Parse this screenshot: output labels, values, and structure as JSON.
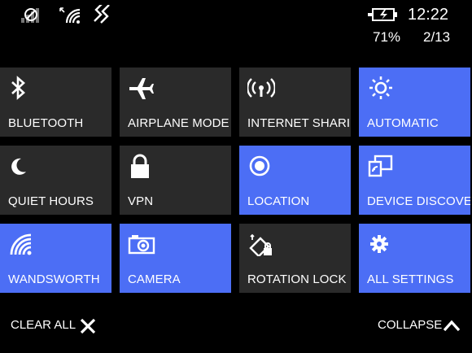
{
  "status_bar": {
    "time": "12:22",
    "battery_percent": "71%",
    "notification_page": "2/13"
  },
  "tiles": [
    {
      "label": "BLUETOOTH",
      "active": false,
      "icon": "bluetooth-icon"
    },
    {
      "label": "AIRPLANE MODE",
      "active": false,
      "icon": "airplane-icon"
    },
    {
      "label": "INTERNET SHARING",
      "active": false,
      "icon": "internet-sharing-icon"
    },
    {
      "label": "AUTOMATIC",
      "active": true,
      "icon": "brightness-icon"
    },
    {
      "label": "QUIET HOURS",
      "active": false,
      "icon": "moon-icon"
    },
    {
      "label": "VPN",
      "active": false,
      "icon": "lock-icon"
    },
    {
      "label": "LOCATION",
      "active": true,
      "icon": "location-icon"
    },
    {
      "label": "DEVICE DISCOVERY",
      "active": true,
      "icon": "device-discovery-icon"
    },
    {
      "label": "WANDSWORTH",
      "active": true,
      "icon": "wifi-icon"
    },
    {
      "label": "CAMERA",
      "active": true,
      "icon": "camera-icon"
    },
    {
      "label": "ROTATION LOCK",
      "active": false,
      "icon": "rotation-lock-icon"
    },
    {
      "label": "ALL SETTINGS",
      "active": true,
      "icon": "gear-icon"
    }
  ],
  "actions": {
    "clear_all": "CLEAR ALL",
    "collapse": "COLLAPSE"
  },
  "colors": {
    "active_tile": "#4c6ef5",
    "inactive_tile": "#2a2a2a",
    "background": "#000000"
  }
}
